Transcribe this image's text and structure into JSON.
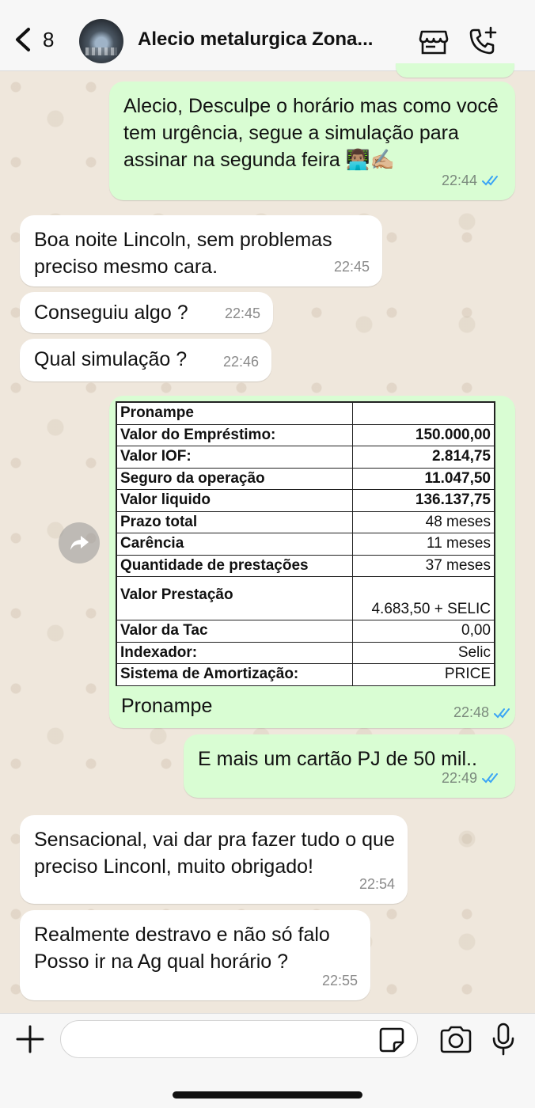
{
  "header": {
    "back_count": "8",
    "contact_name": "Alecio metalurgica Zona..."
  },
  "messages": [
    {
      "text": "Alecio, Desculpe o horário mas como você tem urgência, segue a simulação para assinar na segunda feira 👨🏽‍💻✍🏼",
      "time": "22:44",
      "direction": "out"
    },
    {
      "text": "Boa noite Lincoln, sem problemas preciso mesmo cara.",
      "time": "22:45",
      "direction": "in"
    },
    {
      "text": "Conseguiu algo ?",
      "time": "22:45",
      "direction": "in"
    },
    {
      "text": "Qual simulação ?",
      "time": "22:46",
      "direction": "in"
    },
    {
      "caption": "Pronampe",
      "time": "22:48",
      "direction": "out"
    },
    {
      "text": "E mais um cartão PJ de 50 mil..",
      "time": "22:49",
      "direction": "out"
    },
    {
      "text": "Sensacional, vai dar pra fazer tudo o que preciso Linconl, muito obrigado!",
      "time": "22:54",
      "direction": "in"
    },
    {
      "text": "Realmente destravo e não só falo Posso ir na Ag qual horário ?",
      "time": "22:55",
      "direction": "in"
    }
  ],
  "simulation_table": [
    {
      "label": "Pronampe",
      "value": ""
    },
    {
      "label": "Valor do Empréstimo:",
      "value": "150.000,00"
    },
    {
      "label": "Valor IOF:",
      "value": "2.814,75"
    },
    {
      "label": "Seguro da operação",
      "value": "11.047,50"
    },
    {
      "label": "Valor liquido",
      "value": "136.137,75"
    },
    {
      "label": "Prazo total",
      "value": "48 meses"
    },
    {
      "label": "Carência",
      "value": "11 meses"
    },
    {
      "label": "Quantidade de prestações",
      "value": "37 meses"
    },
    {
      "label": "Valor Prestação",
      "value": "4.683,50 + SELIC"
    },
    {
      "label": "Valor da Tac",
      "value": "0,00"
    },
    {
      "label": "Indexador:",
      "value": "Selic"
    },
    {
      "label": "Sistema de Amortização:",
      "value": "PRICE"
    }
  ],
  "composer": {
    "value": ""
  },
  "colors": {
    "outgoing_bubble": "#d9fdd3",
    "incoming_bubble": "#ffffff",
    "read_ticks": "#3aa4f5"
  },
  "icons": [
    "back-chevron-icon",
    "store-icon",
    "call-add-icon",
    "forward-icon",
    "double-check-icon",
    "plus-icon",
    "sticker-icon",
    "camera-icon",
    "mic-icon"
  ]
}
